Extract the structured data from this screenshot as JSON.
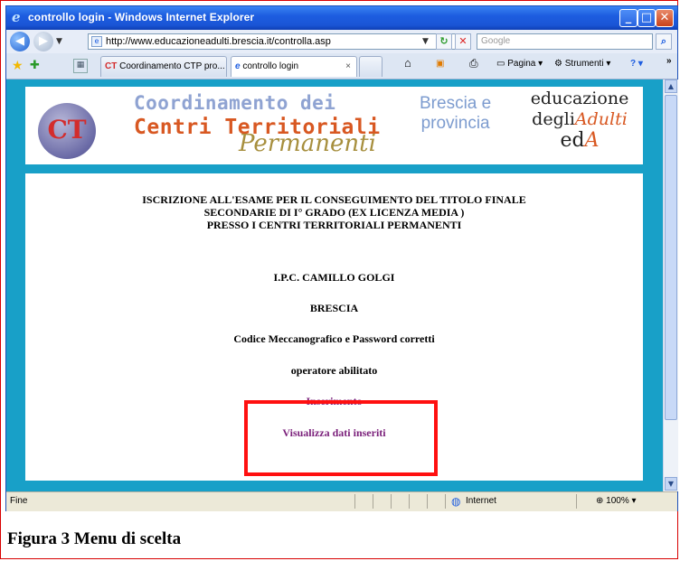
{
  "window": {
    "title": "controllo login - Windows Internet Explorer",
    "icon": "ie-logo-icon"
  },
  "addressbar": {
    "url": "http://www.educazioneadulti.brescia.it/controlla.asp",
    "search_placeholder": "Google"
  },
  "tabs": [
    {
      "label": "Coordinamento CTP pro...",
      "active": false
    },
    {
      "label": "controllo login",
      "active": true
    }
  ],
  "toolbar": {
    "page_label": "Pagina",
    "tools_label": "Strumenti"
  },
  "banner": {
    "line1": "Coordinamento dei",
    "line2": "Centri Territoriali",
    "line3": "Permanenti",
    "place1": "Brescia e",
    "place2": "provincia",
    "brand1": "educazione",
    "brand2_pre": "degli",
    "brand2_acc": "Adulti",
    "brand3_pre": "ed",
    "brand3_acc": "A",
    "logo_text": "CT"
  },
  "main": {
    "heading1": "ISCRIZIONE ALL'ESAME PER IL CONSEGUIMENTO DEL TITOLO FINALE",
    "heading2": "SECONDARIE DI I° GRADO (EX LICENZA MEDIA )",
    "heading3": "PRESSO I CENTRI TERRITORIALI PERMANENTI",
    "school": "I.P.C. CAMILLO GOLGI",
    "city": "BRESCIA",
    "status": "Codice Meccanografico e Password corretti",
    "role": "operatore abilitato",
    "link_insert": "Inserimento",
    "link_view": "Visualizza dati inseriti"
  },
  "statusbar": {
    "text": "Fine",
    "zone": "Internet",
    "zoom": "100%"
  },
  "caption": "Figura 3 Menu di scelta"
}
